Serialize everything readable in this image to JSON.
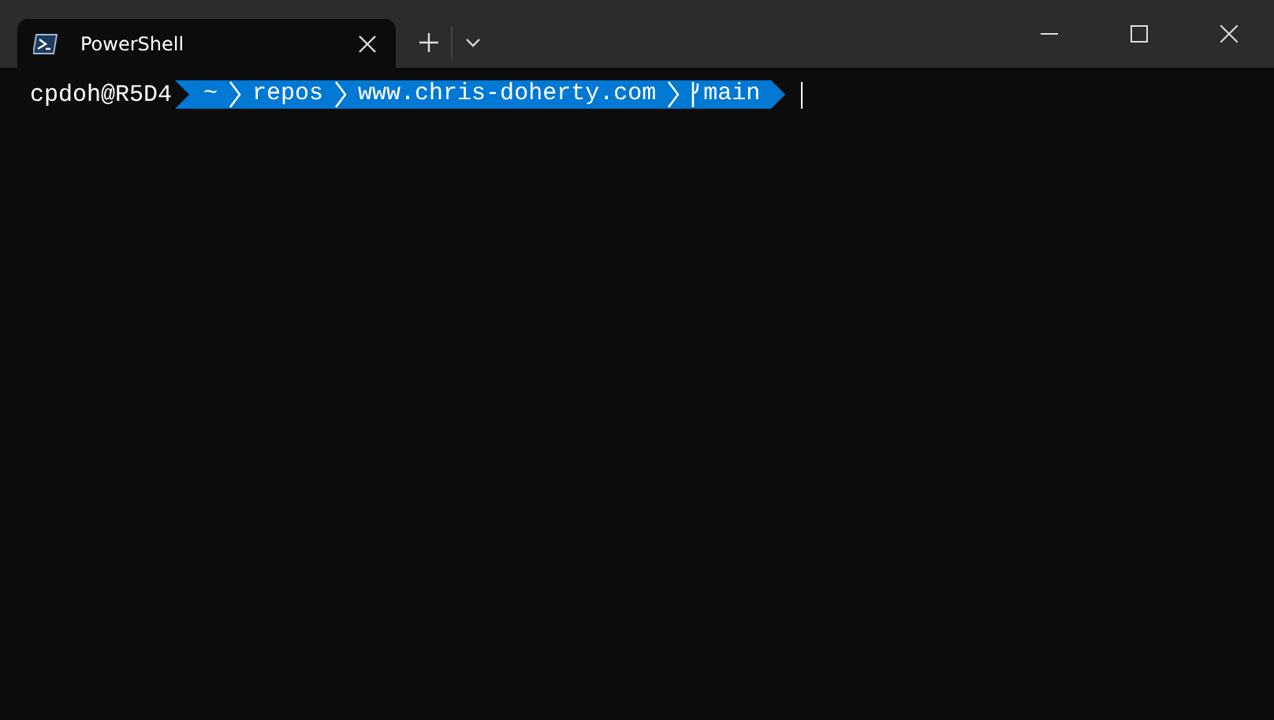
{
  "tabs": [
    {
      "label": "PowerShell",
      "selected": true
    }
  ],
  "prompt": {
    "user": "cpdoh@R5D4",
    "path": [
      "~",
      "repos",
      "www.chris-doherty.com"
    ],
    "branch": "main"
  }
}
